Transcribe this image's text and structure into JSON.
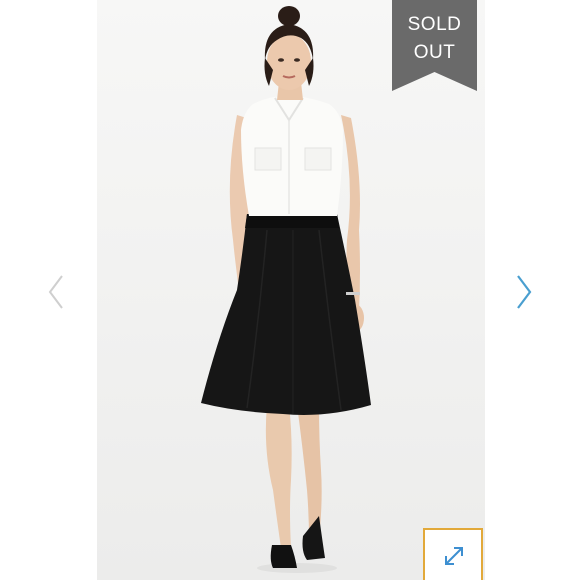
{
  "badge": {
    "line1": "SOLD",
    "line2": "OUT",
    "color": "#6a6a6a"
  },
  "navigation": {
    "prev_icon": "chevron-left-icon",
    "next_icon": "chevron-right-icon",
    "prev_color": "#cfcfcf",
    "next_color": "#4a9fd0"
  },
  "expand": {
    "icon": "expand-arrows-icon",
    "border_color": "#e2a93a",
    "icon_color": "#3d8fd1"
  }
}
